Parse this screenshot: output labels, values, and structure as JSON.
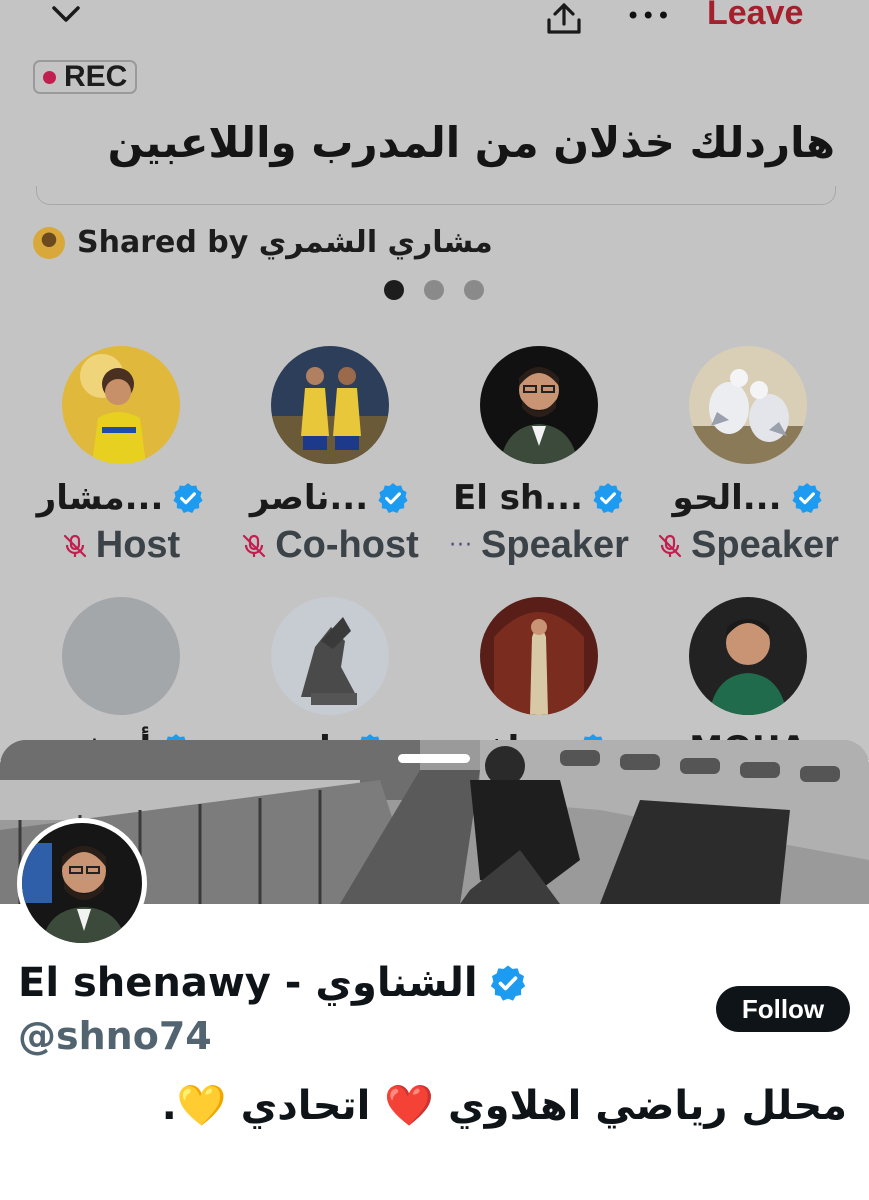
{
  "topbar": {
    "collapse_icon": "chevron-down-icon",
    "share_icon": "share-icon",
    "more_label": "•••",
    "leave_label": "Leave"
  },
  "space": {
    "rec_label": "REC",
    "title": "هاردلك خذلان من المدرب واللاعبين",
    "shared_by": "مشاري الشمري Shared by",
    "page_dots": {
      "count": 3,
      "active": 0
    }
  },
  "speakers": [
    {
      "name": "الحو...",
      "role": "Speaker",
      "verified": true,
      "mic_icon": "mic-off-icon"
    },
    {
      "name": "El sh...",
      "role": "Speaker",
      "verified": true,
      "mic_icon": "ellipsis-icon"
    },
    {
      "name": "ناصر...",
      "role": "Co-host",
      "verified": true,
      "mic_icon": "mic-off-icon"
    },
    {
      "name": "مشار...",
      "role": "Host",
      "verified": true,
      "mic_icon": "mic-off-icon"
    }
  ],
  "listeners_partial": [
    {
      "name": "MOHA"
    },
    {
      "name": "تشاف"
    },
    {
      "name": "ناص"
    },
    {
      "name": "أبوفي"
    }
  ],
  "profile": {
    "display_name": "El shenawy - الشناوي",
    "handle": "@shno74",
    "follow_label": "Follow",
    "bio": "محلل رياضي اهلاوي ❤️ اتحادي 💛.",
    "verified": true
  },
  "colors": {
    "leave": "#a3202c",
    "verified": "#1d9bf0",
    "mic_off": "#c0204f",
    "follow_bg": "#0f1419",
    "rec_dot": "#c0204f"
  }
}
